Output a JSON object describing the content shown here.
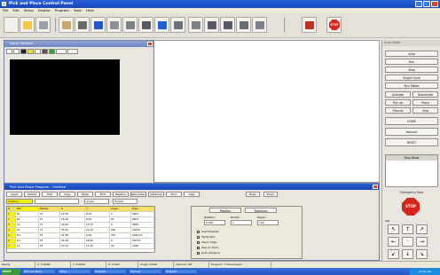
{
  "window": {
    "title": "Pick and Place Control Panel"
  },
  "menu": [
    "File",
    "Edit",
    "Setup",
    "Display",
    "Program",
    "Tools",
    "Help"
  ],
  "toolbar": {
    "buttons": [
      {
        "icon": "new-file-icon",
        "color": "#f0f0f0"
      },
      {
        "icon": "open-folder-icon",
        "color": "#f4c842"
      },
      {
        "icon": "machine-icon",
        "color": "#9aa0a8"
      },
      {
        "icon": "feeder-icon",
        "color": "#c8a86a"
      },
      {
        "icon": "camera-icon",
        "color": "#6a6a6a"
      },
      {
        "icon": "board-icon",
        "color": "#2255cc"
      },
      {
        "icon": "nozzle-icon",
        "color": "#8a8f99"
      },
      {
        "icon": "tray-icon",
        "color": "#7a7f88"
      },
      {
        "icon": "pick-icon",
        "color": "#555a66"
      },
      {
        "icon": "vision-icon",
        "color": "#1e5fd8"
      },
      {
        "icon": "placement-icon",
        "color": "#6a6f78"
      },
      {
        "icon": "calibrate-icon",
        "color": "#7a7f88"
      },
      {
        "icon": "conveyor-icon",
        "color": "#555a66"
      },
      {
        "icon": "tool-change-icon",
        "color": "#555a66"
      },
      {
        "icon": "wrench-icon",
        "color": "#666b74"
      },
      {
        "icon": "phone-icon",
        "color": "#7a7f88"
      },
      {
        "icon": "home-icon",
        "color": "#c03020"
      }
    ],
    "stop_label": "STOP"
  },
  "camera_window": {
    "title": "Vision Window"
  },
  "right_panel": {
    "header": "Auto Mode",
    "buttons": [
      "Auto",
      "Run",
      "Step",
      "Single Cycle",
      "Run Tables"
    ],
    "grid_buttons": [
      [
        "Activate",
        "Deactivate"
      ],
      [
        "Pick Up",
        "Place"
      ],
      [
        "Fiducial",
        "Skip"
      ]
    ],
    "wide_buttons": [
      "HOME",
      "Vacuum",
      "RESET"
    ],
    "list_title": "Step Mode",
    "stop_label": "STOP",
    "stop_caption": "Emergency Stop",
    "jog_title": "Jog"
  },
  "program_window": {
    "title": "Pick and Place Program - Untitled",
    "buttons": [
      "Insert",
      "Delete",
      "Edit",
      "Copy",
      "Paste",
      "Find",
      "Replace",
      "Renumber",
      "Optimize",
      "Print",
      "Help"
    ],
    "right_buttons": [
      "Rows",
      "Zoom"
    ],
    "fields": [
      "Position",
      "",
      "Angle",
      "Height"
    ],
    "grid": {
      "headers": [
        "#",
        "Part",
        "Feeder",
        "X",
        "Y",
        "Angle",
        "Type"
      ],
      "rows": [
        [
          "1",
          "R1",
          "F1",
          "12.50",
          "8.25",
          "0",
          "0603"
        ],
        [
          "2",
          "R2",
          "F1",
          "18.20",
          "8.25",
          "90",
          "0603"
        ],
        [
          "3",
          "C1",
          "F3",
          "24.00",
          "15.75",
          "0",
          "0805"
        ],
        [
          "4",
          "U1",
          "T1",
          "35.40",
          "22.10",
          "180",
          "SOIC8"
        ],
        [
          "5",
          "D1",
          "F4",
          "41.80",
          "9.60",
          "270",
          "SOD123"
        ],
        [
          "6",
          "Q1",
          "F5",
          "28.30",
          "30.00",
          "0",
          "SOT23"
        ],
        [
          "7",
          "L1",
          "F6",
          "50.10",
          "12.40",
          "90",
          "1206"
        ]
      ]
    },
    "options": {
      "tabs": [
        "Position",
        "Tolerance"
      ],
      "labels": [
        "Rotation",
        "Nozzle",
        "Speed"
      ],
      "values": [
        "0.000",
        "1",
        "100"
      ],
      "checks": [
        "Use Fiducials",
        "Verify Part",
        "Vision Align",
        "Skip on Error",
        "Auto Advance"
      ]
    }
  },
  "statusbar": [
    "Ready",
    "X: 0.0000",
    "Y: 0.0000",
    "Z: 0.000",
    "Angle: 0.000",
    "Vacuum: Off",
    "Program: 7 Placements"
  ],
  "taskbar": {
    "start": "start",
    "tasks": [
      "Pick and Place",
      "Vision",
      "Program",
      "Explorer",
      "Notepad"
    ],
    "clock": "10:42 AM"
  }
}
